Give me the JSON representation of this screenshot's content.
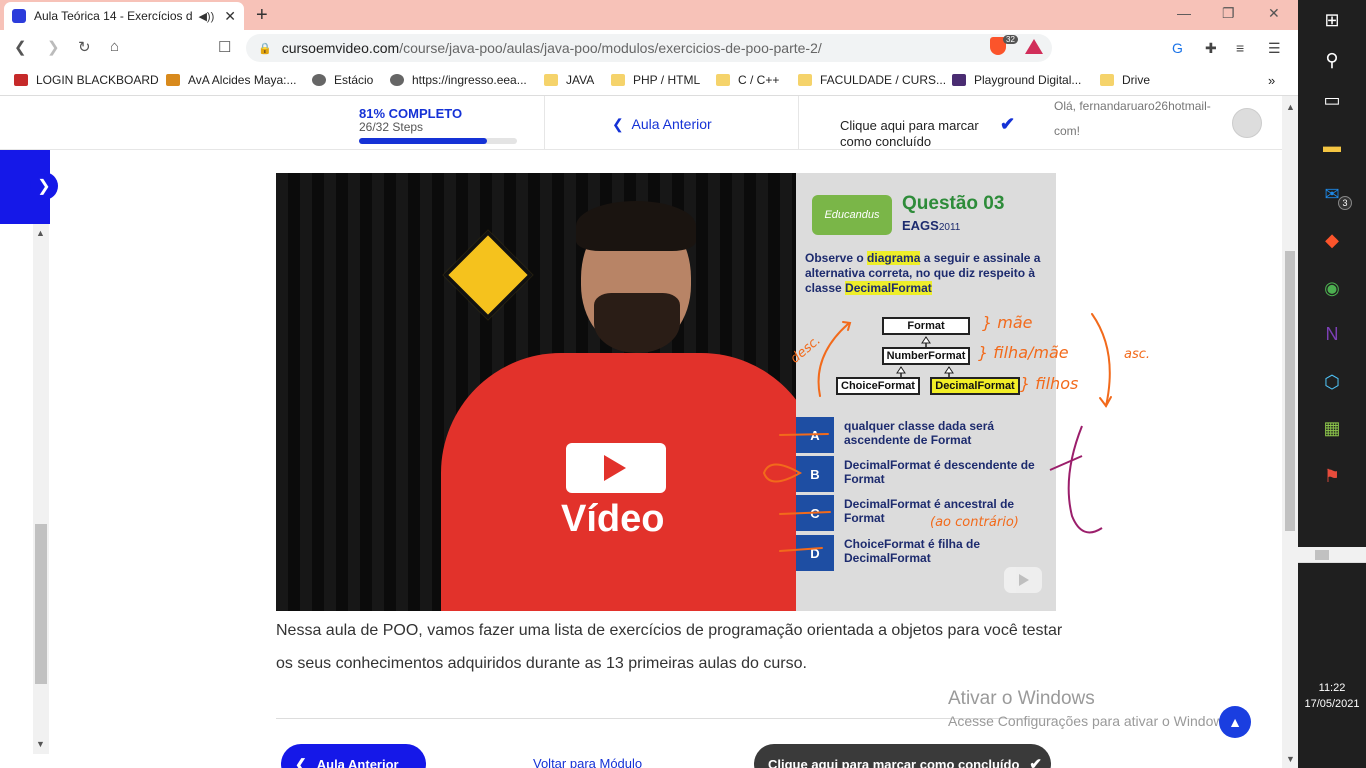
{
  "browser": {
    "tab_title": "Aula Teórica 14 - Exercícios de",
    "url_host": "cursoemvideo.com",
    "url_path": "/course/java-poo/aulas/java-poo/modulos/exercicios-de-poo-parte-2/",
    "brave_badge": "32",
    "bookmarks": [
      "LOGIN BLACKBOARD",
      "AvA Alcides Maya:...",
      "Estácio",
      "https://ingresso.eea...",
      "JAVA",
      "PHP / HTML",
      "C / C++",
      "FACULDADE / CURS...",
      "Playground Digital...",
      "Drive"
    ]
  },
  "course_header": {
    "progress_label": "81% COMPLETO",
    "progress_steps": "26/32 Steps",
    "progress_value": 0.81,
    "prev_lesson": "Aula Anterior",
    "mark_complete": "Clique aqui para marcar como concluído",
    "greeting": "Olá, fernandaruaro26hotmail-com!"
  },
  "video_slide": {
    "logo_text": "Educandus",
    "question_title": "Questão 03",
    "question_source": "EAGS",
    "question_year": "2011",
    "prompt_parts": [
      "Observe o ",
      "diagrama",
      " a seguir e assinale a alternativa correta, no que diz respeito à classe ",
      "DecimalFormat"
    ],
    "diagram_classes": [
      "Format",
      "NumberFormat",
      "ChoiceFormat",
      "DecimalFormat"
    ],
    "options": [
      {
        "letter": "A",
        "text": "qualquer classe dada será ascendente de Format"
      },
      {
        "letter": "B",
        "text": "DecimalFormat é descendente de Format"
      },
      {
        "letter": "C",
        "text": "DecimalFormat é ancestral de Format"
      },
      {
        "letter": "D",
        "text": "ChoiceFormat é filha de DecimalFormat"
      }
    ],
    "handwritten": {
      "mae": "} mãe",
      "filha_mae": "} filha/mãe",
      "filhos": "} filhos",
      "desc": "desc.",
      "asc": "asc.",
      "contrario": "(ao contrário)"
    },
    "brand_on_shirt": "Vídeo"
  },
  "description": "Nessa aula de POO, vamos fazer uma lista de exercícios de programação orientada a objetos para você testar os seus conhecimentos adquiridos durante as 13 primeiras aulas do curso.",
  "footer_nav": {
    "prev_button": "Aula Anterior",
    "back_module": "Voltar para Módulo",
    "complete_button": "Clique aqui para marcar como concluído"
  },
  "windows_watermark": {
    "title": "Ativar o Windows",
    "subtitle": "Acesse Configurações para ativar o Windows."
  },
  "taskbar": {
    "mail_badge": "3",
    "time": "11:22",
    "date": "17/05/2021"
  },
  "colors": {
    "accent_blue": "#1518e8",
    "tab_strip": "#f7c2b8",
    "annotation_orange": "#f26a1b",
    "annotation_purple": "#9b1e6b"
  }
}
